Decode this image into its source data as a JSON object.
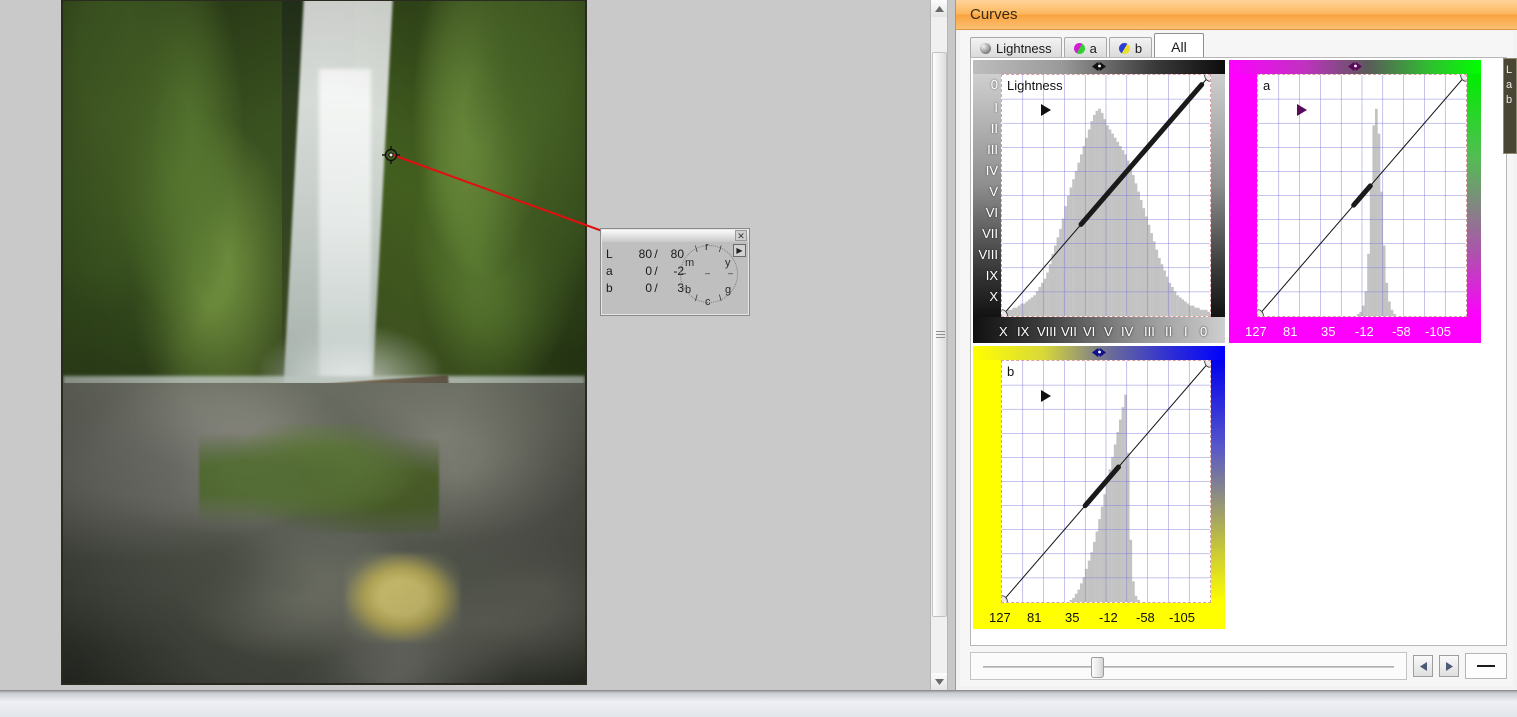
{
  "window": {
    "title": "Curves"
  },
  "tabs": [
    {
      "label": "Lightness",
      "icon": "sphere-gray-icon",
      "active": false
    },
    {
      "label": "a",
      "icon": "sphere-magenta-green-icon",
      "active": false
    },
    {
      "label": "b",
      "icon": "sphere-yellow-blue-icon",
      "active": false
    },
    {
      "label": "All",
      "icon": "",
      "active": true
    }
  ],
  "lab_popup": {
    "close_icon": "close-icon",
    "expand_icon": "expand-icon",
    "rows": [
      {
        "channel": "L",
        "before": "80",
        "separator": "/",
        "after": "80"
      },
      {
        "channel": "a",
        "before": "0",
        "separator": "/",
        "after": "-2"
      },
      {
        "channel": "b",
        "before": "0",
        "separator": "/",
        "after": "3"
      }
    ],
    "wheel_labels": [
      "r",
      "y",
      "g",
      "c",
      "b",
      "m"
    ],
    "wheel_ticks": [
      "\\",
      "/",
      "–",
      "–",
      "–",
      "/",
      "\\"
    ]
  },
  "slider": {
    "value_percent": 27,
    "prev_icon": "arrow-left-icon",
    "next_icon": "arrow-right-icon",
    "minus_icon": "minus-icon"
  },
  "edge_panel": {
    "lines": [
      "L",
      "a",
      "b"
    ]
  },
  "scrollbar": {
    "up_icon": "arrow-up-icon",
    "down_icon": "arrow-down-icon",
    "thumb_position_percent": 9
  },
  "chart_data": [
    {
      "id": "lightness",
      "type": "line",
      "title": "Lightness",
      "xlabel": "",
      "ylabel": "",
      "x_ticks": [
        "X",
        "IX",
        "VIII",
        "VII",
        "VI",
        "V",
        "IV",
        "III",
        "II",
        "I",
        "0"
      ],
      "y_ticks": [
        "0",
        "I",
        "II",
        "III",
        "IV",
        "V",
        "VI",
        "VII",
        "VIII",
        "IX",
        "X"
      ],
      "xlim": [
        0,
        100
      ],
      "ylim": [
        0,
        100
      ],
      "grid": true,
      "gradient_from": "#cfcfcf",
      "gradient_to": "#0d0d0d",
      "curve_points": [
        [
          0,
          0
        ],
        [
          100,
          100
        ]
      ],
      "highlight_segment": [
        [
          38,
          38
        ],
        [
          96,
          96
        ]
      ],
      "endpoint_markers": [
        [
          0,
          0
        ],
        [
          100,
          100
        ]
      ],
      "histogram": [
        2,
        2,
        3,
        3,
        4,
        4,
        5,
        6,
        6,
        7,
        8,
        9,
        10,
        12,
        14,
        16,
        18,
        21,
        25,
        30,
        34,
        38,
        42,
        47,
        53,
        58,
        62,
        66,
        70,
        74,
        78,
        82,
        86,
        90,
        94,
        97,
        99,
        100,
        98,
        95,
        92,
        90,
        88,
        86,
        84,
        82,
        80,
        78,
        75,
        72,
        68,
        64,
        60,
        56,
        52,
        48,
        44,
        40,
        36,
        32,
        28,
        25,
        22,
        19,
        16,
        14,
        12,
        10,
        9,
        8,
        7,
        6,
        5,
        5,
        4,
        4,
        3,
        3,
        3,
        2
      ]
    },
    {
      "id": "a",
      "type": "line",
      "title": "a",
      "xlabel": "",
      "ylabel": "",
      "x_ticks": [
        "127",
        "81",
        "35",
        "-12",
        "-58",
        "-105"
      ],
      "y_ticks": [],
      "xlim": [
        127,
        -128
      ],
      "ylim": [
        127,
        -128
      ],
      "grid": true,
      "gradient_from": "#ff00ff",
      "gradient_to": "#00ff00",
      "curve_points": [
        [
          0,
          0
        ],
        [
          100,
          100
        ]
      ],
      "highlight_segment": [
        [
          46,
          46
        ],
        [
          54,
          54
        ]
      ],
      "endpoint_markers": [
        [
          0,
          0
        ],
        [
          100,
          100
        ]
      ],
      "histogram": [
        0,
        0,
        0,
        0,
        0,
        0,
        0,
        0,
        0,
        0,
        0,
        0,
        0,
        0,
        0,
        0,
        0,
        0,
        0,
        0,
        0,
        0,
        0,
        0,
        0,
        0,
        0,
        0,
        0,
        0,
        0,
        0,
        0,
        0,
        0,
        0,
        0,
        0,
        1,
        2,
        5,
        12,
        30,
        62,
        92,
        100,
        88,
        60,
        34,
        16,
        7,
        3,
        1,
        0,
        0,
        0,
        0,
        0,
        0,
        0,
        0,
        0,
        0,
        0,
        0,
        0,
        0,
        0,
        0,
        0,
        0,
        0,
        0,
        0,
        0,
        0,
        0,
        0,
        0,
        0
      ]
    },
    {
      "id": "b",
      "type": "line",
      "title": "b",
      "xlabel": "",
      "ylabel": "",
      "x_ticks": [
        "127",
        "81",
        "35",
        "-12",
        "-58",
        "-105"
      ],
      "y_ticks": [],
      "xlim": [
        127,
        -128
      ],
      "ylim": [
        127,
        -128
      ],
      "grid": true,
      "gradient_from": "#ffff00",
      "gradient_to": "#0000ff",
      "curve_points": [
        [
          0,
          0
        ],
        [
          100,
          100
        ]
      ],
      "highlight_segment": [
        [
          40,
          40
        ],
        [
          56,
          56
        ]
      ],
      "endpoint_markers": [
        [
          0,
          0
        ],
        [
          100,
          100
        ]
      ],
      "histogram": [
        0,
        0,
        0,
        0,
        0,
        0,
        0,
        0,
        0,
        0,
        0,
        0,
        0,
        0,
        0,
        0,
        0,
        0,
        0,
        0,
        0,
        0,
        0,
        0,
        0,
        0,
        1,
        2,
        4,
        6,
        9,
        12,
        16,
        20,
        24,
        29,
        34,
        40,
        46,
        52,
        58,
        64,
        70,
        76,
        82,
        88,
        94,
        100,
        72,
        30,
        10,
        3,
        1,
        0,
        0,
        0,
        0,
        0,
        0,
        0,
        0,
        0,
        0,
        0,
        0,
        0,
        0,
        0,
        0,
        0,
        0,
        0,
        0,
        0,
        0,
        0,
        0,
        0,
        0,
        0
      ]
    }
  ]
}
